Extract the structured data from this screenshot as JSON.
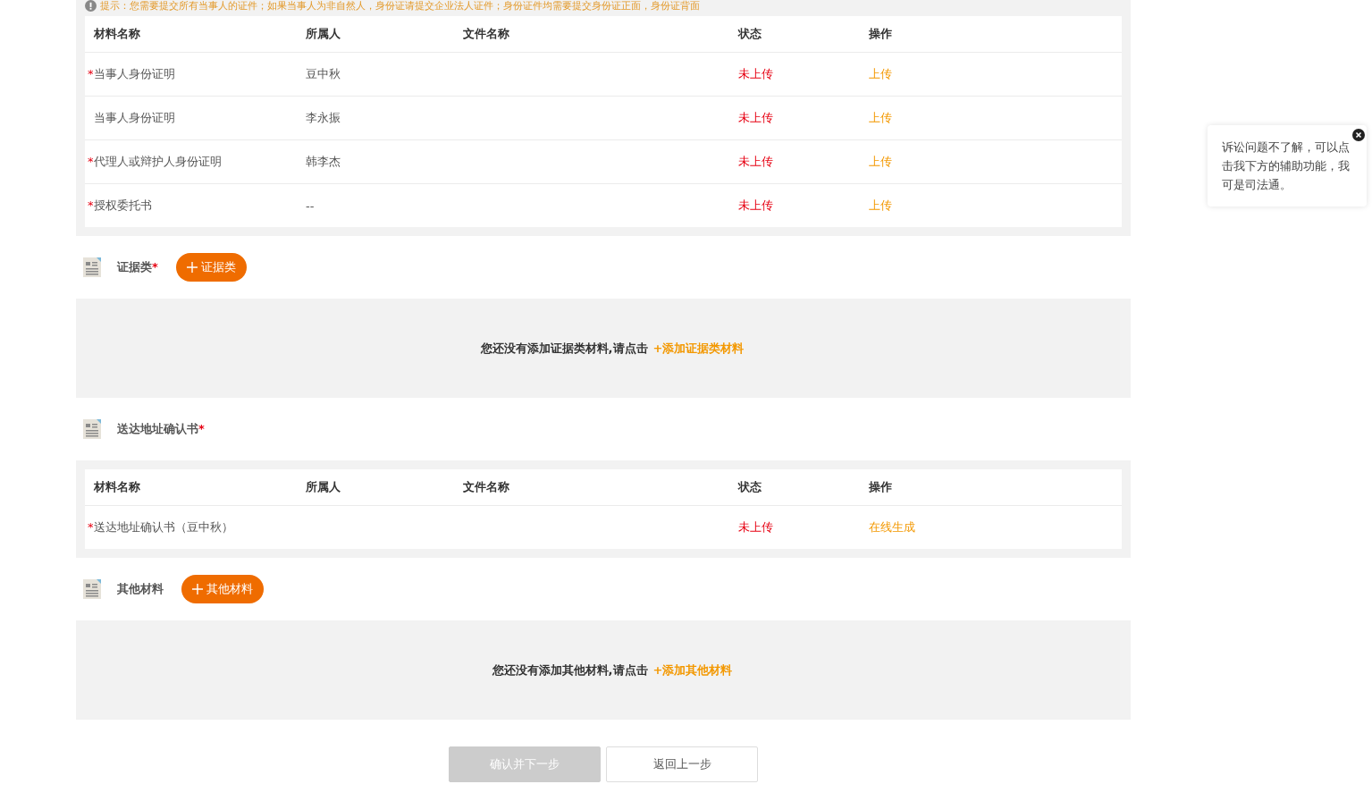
{
  "required_mark": "*",
  "notice": "提示：您需要提交所有当事人的证件；如果当事人为非自然人，身份证请提交企业法人证件；身份证件均需要提交身份证正面，身份证背面",
  "sections": [
    {
      "kind": "table",
      "columns": [
        "材料名称",
        "所属人",
        "文件名称",
        "状态",
        "操作"
      ],
      "rows": [
        {
          "name": "当事人身份证明",
          "required": true,
          "owner": "豆中秋",
          "file": "",
          "status": "未上传",
          "action": "上传"
        },
        {
          "name": "当事人身份证明",
          "required": false,
          "owner": "李永振",
          "file": "",
          "status": "未上传",
          "action": "上传"
        },
        {
          "name": "代理人或辩护人身份证明",
          "required": true,
          "owner": "韩李杰",
          "file": "",
          "status": "未上传",
          "action": "上传"
        },
        {
          "name": "授权委托书",
          "required": true,
          "owner": "--",
          "file": "",
          "status": "未上传",
          "action": "上传"
        }
      ]
    },
    {
      "kind": "empty",
      "title": "证据类",
      "required": true,
      "add_button": "证据类",
      "empty_text": "您还没有添加证据类材料,请点击",
      "empty_link": "+添加证据类材料"
    },
    {
      "kind": "table",
      "title": "送达地址确认书",
      "required": true,
      "columns": [
        "材料名称",
        "所属人",
        "文件名称",
        "状态",
        "操作"
      ],
      "rows": [
        {
          "name": "送达地址确认书（豆中秋）",
          "required": true,
          "owner": "",
          "file": "",
          "status": "未上传",
          "action": "在线生成"
        }
      ]
    },
    {
      "kind": "empty",
      "title": "其他材料",
      "required": false,
      "add_button": "其他材料",
      "empty_text": "您还没有添加其他材料,请点击",
      "empty_link": "+添加其他材料"
    }
  ],
  "buttons": [
    {
      "label": "确认并下一步",
      "disabled": true
    },
    {
      "label": "返回上一步",
      "disabled": false
    }
  ],
  "tooltip": {
    "text": "诉讼问题不了解，可以点击我下方的辅助功能，我可是司法通。"
  }
}
